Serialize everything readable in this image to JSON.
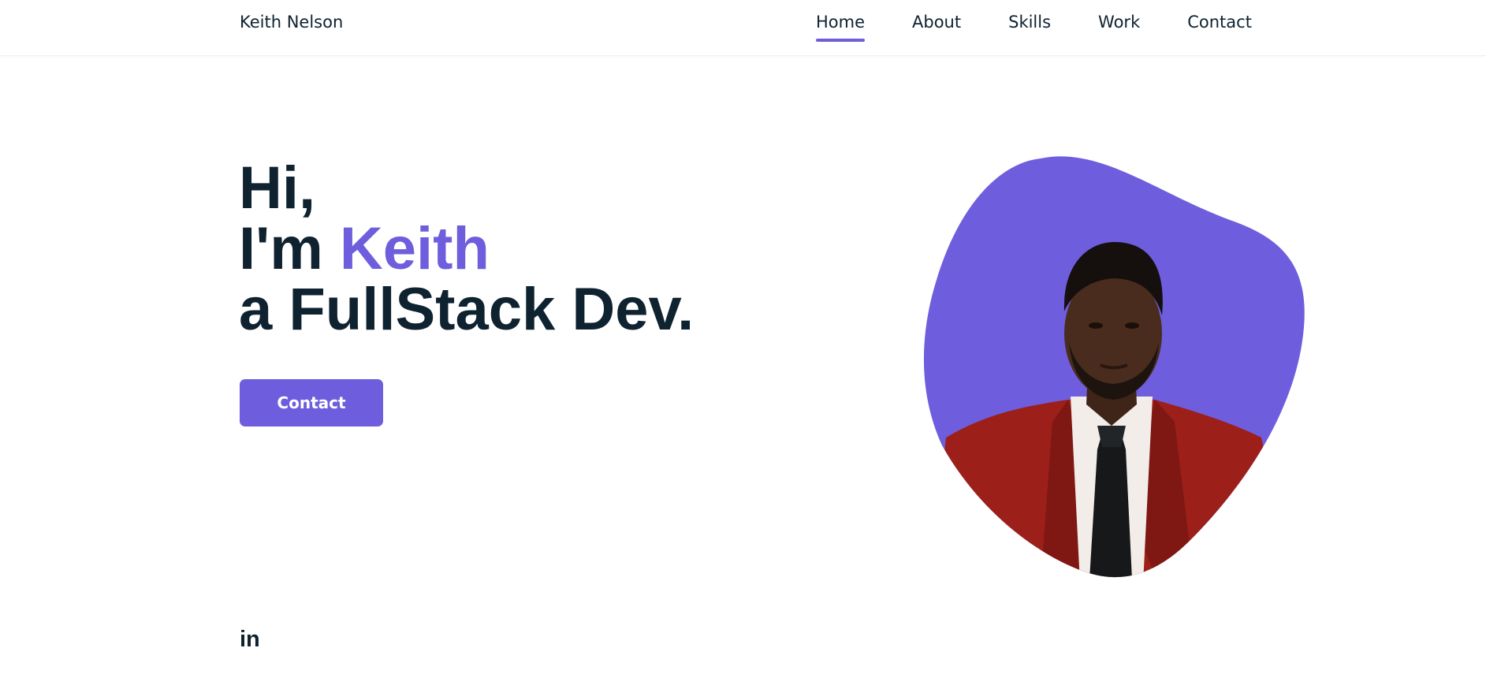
{
  "header": {
    "logo": "Keith Nelson",
    "nav": [
      {
        "label": "Home",
        "active": true
      },
      {
        "label": "About",
        "active": false
      },
      {
        "label": "Skills",
        "active": false
      },
      {
        "label": "Work",
        "active": false
      },
      {
        "label": "Contact",
        "active": false
      }
    ]
  },
  "hero": {
    "greeting": "Hi,",
    "intro_prefix": "I'm ",
    "name": "Keith",
    "role": "a FullStack Dev.",
    "contact_button": "Contact",
    "image_icon": "portrait-photo"
  },
  "social": {
    "linkedin": "in",
    "linkedin_icon": "linkedin-icon"
  },
  "colors": {
    "accent": "#6e5edd",
    "text": "#0f2230",
    "background": "#ffffff",
    "jacket": "#9c1f1a",
    "shirt": "#f2ede8",
    "skin": "#4a2c1e"
  }
}
